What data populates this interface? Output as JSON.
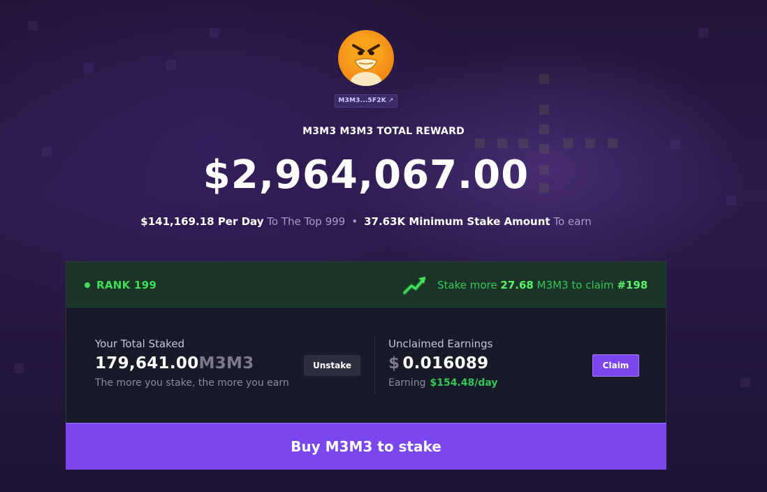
{
  "token": {
    "address_short": "M3M3...5F2K",
    "external_link_icon": "external-link-icon",
    "avatar_icon": "duck-mascot-avatar"
  },
  "reward": {
    "title": "M3M3 M3M3 TOTAL REWARD",
    "amount": "$2,964,067.00",
    "per_day_value": "$141,169.18 Per Day",
    "per_day_suffix": "To The Top 999",
    "separator": "•",
    "min_stake_value": "37.63K Minimum Stake Amount",
    "min_stake_suffix": "To earn"
  },
  "rank": {
    "label": "RANK 199",
    "stake_more_prefix": "Stake more",
    "stake_more_amount": "27.68",
    "stake_more_middle": "M3M3 to claim",
    "target_rank": "#198"
  },
  "staked": {
    "label": "Your Total Staked",
    "value": "179,641.00",
    "unit": "M3M3",
    "note": "The more you stake, the more you earn",
    "unstake_label": "Unstake"
  },
  "earnings": {
    "label": "Unclaimed Earnings",
    "currency": "$",
    "value": "0.016089",
    "earning_label": "Earning",
    "earning_rate": "$154.48/day",
    "claim_label": "Claim"
  },
  "buy": {
    "label": "Buy M3M3 to stake"
  },
  "colors": {
    "accent_purple": "#7a46f0",
    "rank_green": "#3fdc58",
    "card_bg": "#171a27"
  }
}
